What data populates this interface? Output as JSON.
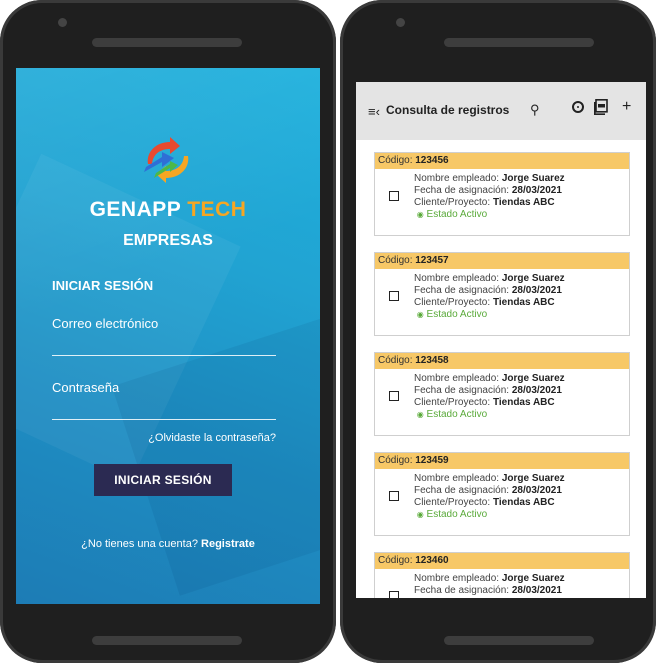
{
  "login": {
    "brand_part1": "GENAPP",
    "brand_part2": "TECH",
    "subtitle": "EMPRESAS",
    "section_title": "INICIAR SESIÓN",
    "email_label": "Correo electrónico",
    "password_label": "Contraseña",
    "forgot_link": "¿Olvidaste la contraseña?",
    "login_button": "INICIAR SESIÓN",
    "signup_prompt": "¿No tienes una cuenta?",
    "signup_link": "Registrate",
    "colors": {
      "background": "#1fa3d3",
      "button": "#2b2a52",
      "accent": "#f5a623"
    }
  },
  "records": {
    "title": "Consulta de registros",
    "icons": [
      "menu-icon",
      "search-icon",
      "target-icon",
      "pdf-icon",
      "add-icon"
    ],
    "code_label": "Código:",
    "employee_label": "Nombre empleado:",
    "date_label": "Fecha de asignación:",
    "client_label": "Cliente/Proyecto:",
    "items": [
      {
        "code": "123456",
        "employee": "Jorge Suarez",
        "date": "28/03/2021",
        "client": "Tiendas ABC",
        "status": "Estado Activo"
      },
      {
        "code": "123457",
        "employee": "Jorge Suarez",
        "date": "28/03/2021",
        "client": "Tiendas ABC",
        "status": "Estado Activo"
      },
      {
        "code": "123458",
        "employee": "Jorge Suarez",
        "date": "28/03/2021",
        "client": "Tiendas ABC",
        "status": "Estado Activo"
      },
      {
        "code": "123459",
        "employee": "Jorge Suarez",
        "date": "28/03/2021",
        "client": "Tiendas ABC",
        "status": "Estado Activo"
      },
      {
        "code": "123460",
        "employee": "Jorge Suarez",
        "date": "28/03/2021",
        "client": "",
        "status": ""
      }
    ],
    "colors": {
      "code_bar": "#f7c867",
      "status": "#5aaa3a",
      "appbar": "#e4e4e4"
    }
  }
}
